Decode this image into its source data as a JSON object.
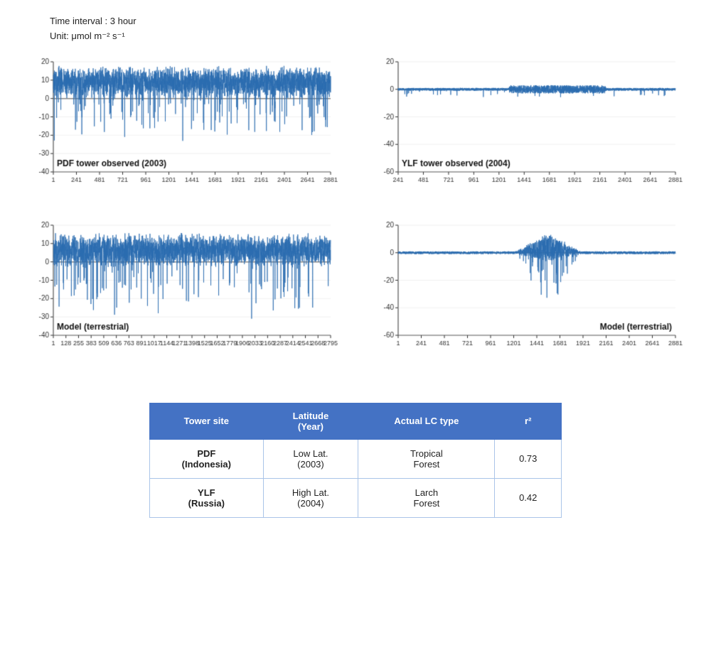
{
  "header": {
    "time_interval": "Time interval : 3 hour",
    "unit": "Unit: μmol m⁻² s⁻¹"
  },
  "charts": [
    {
      "id": "chart1",
      "label": "PDF tower observed (2003)",
      "label_position": "left",
      "y_min": -40,
      "y_max": 20,
      "y_ticks": [
        20,
        10,
        0,
        -10,
        -20,
        -30,
        -40
      ],
      "x_ticks": [
        "1",
        "241",
        "481",
        "721",
        "961",
        "1201",
        "1441",
        "1681",
        "1921",
        "2161",
        "2401",
        "2641",
        "2881"
      ]
    },
    {
      "id": "chart2",
      "label": "YLF tower observed (2004)",
      "label_position": "left",
      "y_min": -60,
      "y_max": 20,
      "y_ticks": [
        20,
        0,
        -20,
        -40,
        -60
      ],
      "x_ticks": [
        "241",
        "481",
        "721",
        "961",
        "1201",
        "1441",
        "1681",
        "1921",
        "2161",
        "2401",
        "2641",
        "2881"
      ]
    },
    {
      "id": "chart3",
      "label": "Model (terrestrial)",
      "label_position": "left",
      "y_min": -40,
      "y_max": 20,
      "y_ticks": [
        20,
        10,
        0,
        -10,
        -20,
        -30,
        -40
      ],
      "x_ticks": [
        "1",
        "128",
        "255",
        "383",
        "509",
        "636",
        "763",
        "891",
        "1017",
        "1144",
        "1271",
        "1398",
        "1525",
        "1652",
        "1779",
        "1906",
        "2033",
        "2160",
        "2287",
        "2414",
        "2541",
        "2668",
        "2795"
      ]
    },
    {
      "id": "chart4",
      "label": "Model (terrestrial)",
      "label_position": "right",
      "y_min": -60,
      "y_max": 20,
      "y_ticks": [
        20,
        0,
        -20,
        -40,
        -60
      ],
      "x_ticks": [
        "1",
        "241",
        "481",
        "721",
        "961",
        "1201",
        "1441",
        "1681",
        "1921",
        "2161",
        "2401",
        "2641",
        "2881"
      ]
    }
  ],
  "table": {
    "headers": [
      "Tower site",
      "Latitude\n(Year)",
      "Actual LC type",
      "r²"
    ],
    "rows": [
      {
        "tower_site": "PDF\n(Indonesia)",
        "latitude": "Low Lat.\n(2003)",
        "lc_type": "Tropical\nForest",
        "r2": "0.73"
      },
      {
        "tower_site": "YLF\n(Russia)",
        "latitude": "High Lat.\n(2004)",
        "lc_type": "Larch\nForest",
        "r2": "0.42"
      }
    ]
  }
}
